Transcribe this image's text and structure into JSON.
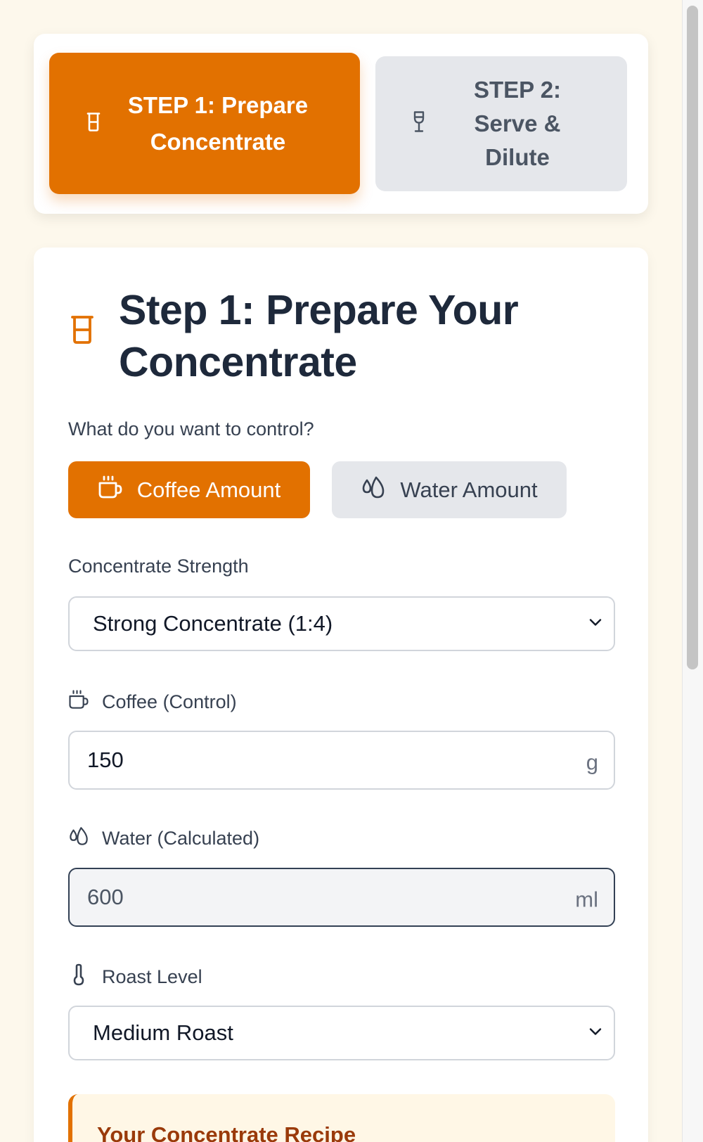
{
  "steps": {
    "step1": {
      "label": "STEP 1: Prepare Concentrate",
      "icon": "beaker-icon"
    },
    "step2": {
      "label": "STEP 2: Serve & Dilute",
      "icon": "wine-glass-icon"
    }
  },
  "main": {
    "title": "Step 1: Prepare Your Concentrate",
    "question": "What do you want to control?",
    "toggle": {
      "coffee": "Coffee Amount",
      "water": "Water Amount",
      "selected": "coffee"
    },
    "strength": {
      "label": "Concentrate Strength",
      "value": "Strong Concentrate (1:4)"
    },
    "coffee": {
      "label": "Coffee (Control)",
      "value": "150",
      "unit": "g"
    },
    "water": {
      "label": "Water (Calculated)",
      "value": "600",
      "unit": "ml"
    },
    "roast": {
      "label": "Roast Level",
      "value": "Medium Roast"
    },
    "recipe": {
      "title": "Your Concentrate Recipe"
    }
  },
  "colors": {
    "accent": "#e27100",
    "background": "#fdf8ec",
    "recipe_title": "#9a3a0a"
  }
}
